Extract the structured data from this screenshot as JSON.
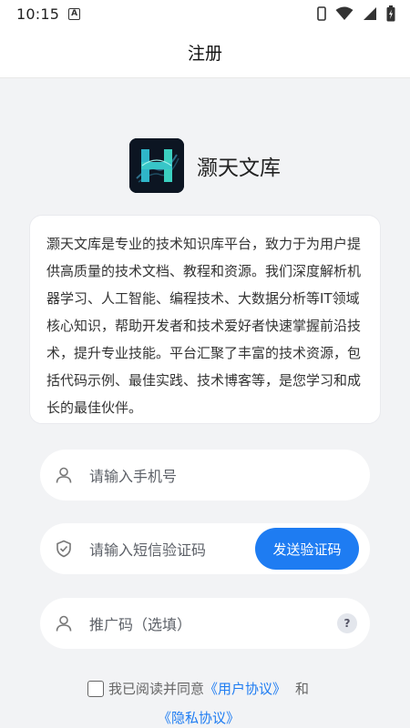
{
  "status_bar": {
    "time": "10:15",
    "a_icon": "A"
  },
  "header": {
    "title": "注册"
  },
  "brand": {
    "logo_letter": "H",
    "name": "灏天文库"
  },
  "intro": {
    "text": "灏天文库是专业的技术知识库平台，致力于为用户提供高质量的技术文档、教程和资源。我们深度解析机器学习、人工智能、编程技术、大数据分析等IT领域核心知识，帮助开发者和技术爱好者快速掌握前沿技术，提升专业技能。平台汇聚了丰富的技术资源，包括代码示例、最佳实践、技术博客等，是您学习和成长的最佳伙伴。"
  },
  "form": {
    "phone_placeholder": "请输入手机号",
    "code_placeholder": "请输入短信验证码",
    "send_code_label": "发送验证码",
    "promo_placeholder": "推广码（选填）",
    "help_label": "?"
  },
  "agreement": {
    "prefix": "我已阅读并同意",
    "user_agreement": "《用户协议》",
    "and": "和",
    "privacy_policy": "《隐私协议》"
  },
  "colors": {
    "accent": "#1e7cf2",
    "background": "#f2f3f5"
  }
}
